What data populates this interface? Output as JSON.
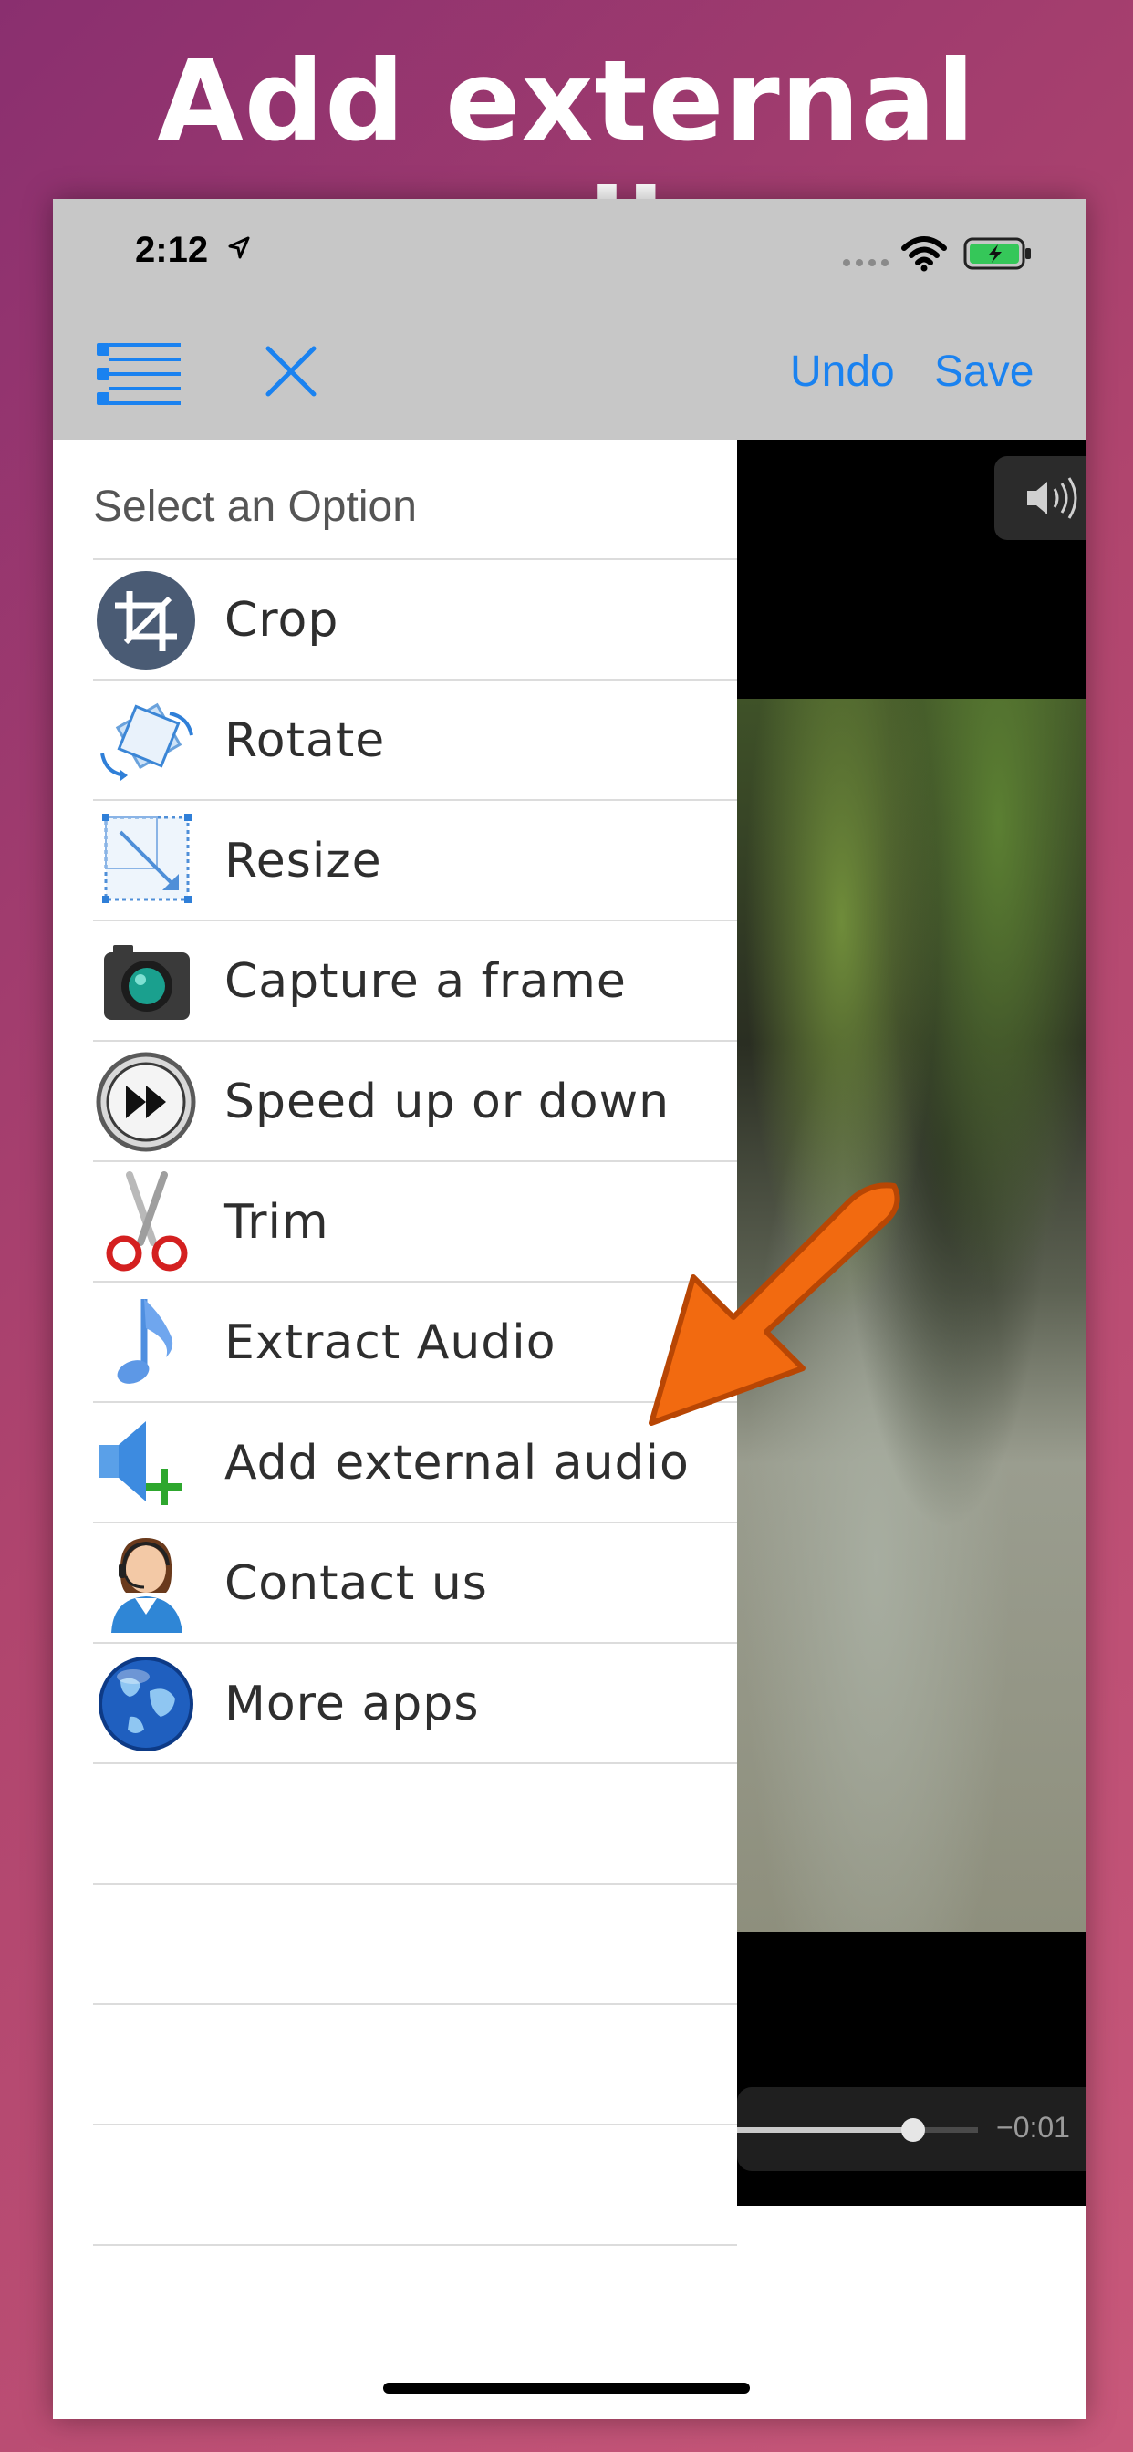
{
  "headline": "Add external audio",
  "status": {
    "time": "2:12"
  },
  "nav": {
    "undo": "Undo",
    "save": "Save"
  },
  "menu": {
    "header": "Select an Option",
    "items": [
      {
        "label": "Crop",
        "icon": "crop-icon"
      },
      {
        "label": "Rotate",
        "icon": "rotate-icon"
      },
      {
        "label": "Resize",
        "icon": "resize-icon"
      },
      {
        "label": "Capture a frame",
        "icon": "camera-icon"
      },
      {
        "label": "Speed up or down",
        "icon": "fast-forward-icon"
      },
      {
        "label": "Trim",
        "icon": "scissors-icon"
      },
      {
        "label": "Extract Audio",
        "icon": "music-note-icon"
      },
      {
        "label": "Add external audio",
        "icon": "speaker-add-icon"
      },
      {
        "label": "Contact us",
        "icon": "support-agent-icon"
      },
      {
        "label": "More apps",
        "icon": "globe-icon"
      }
    ]
  },
  "player": {
    "remaining_time": "−0:01",
    "progress": 0.73
  },
  "colors": {
    "accent": "#1a82f0",
    "callout": "#f26a10",
    "bar": "#c7c7c7"
  }
}
